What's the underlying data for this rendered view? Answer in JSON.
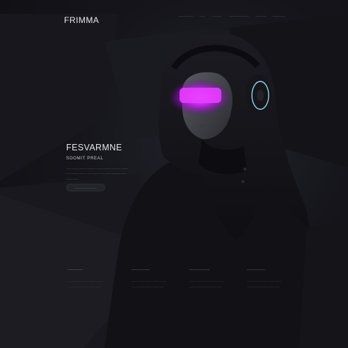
{
  "header": {
    "logo": "FRIMMA",
    "nav": [
      "——————",
      "——",
      "————",
      "————————",
      "————",
      "—————"
    ]
  },
  "hero": {
    "title": "FESVARMNE",
    "subtitle": "SOOMIT PREAL",
    "body": "—— ——— ——— ———— ——— ——— ———— ——— —— ——— ——— —— ——— —— ——— ———— —— ——— ——",
    "cta_label": "——————————"
  },
  "features": [
    {
      "heading": "——————",
      "text": "——— ——— ——— ——— ——— ——— ——— ——— ——— ——"
    },
    {
      "heading": "———————",
      "text": "——— ——— ——— ——— ——— ——— ——— ——— ——— ——"
    },
    {
      "heading": "————————",
      "text": "——— ——— ——— ——— ——— ——— ——— ——— ——— ——"
    },
    {
      "heading": "———————",
      "text": "——— ——— ——— ——— ——— ——— ——— ——— ——— ——"
    }
  ],
  "colors": {
    "background": "#121217",
    "accent_glow": "#d21cff",
    "headphone_ring": "#8fd6ee"
  },
  "icons": [
    "headphones-icon"
  ]
}
